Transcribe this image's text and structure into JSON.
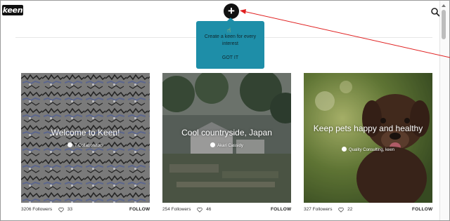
{
  "header": {
    "logo": "keen",
    "add_symbol": "+",
    "search_icon": "search-icon"
  },
  "tooltip": {
    "text": "Create a keen for every interest",
    "button": "GOT IT",
    "icon": "pointing-hand-icon"
  },
  "colors": {
    "tooltip_bg": "#1e8ea8",
    "arrow": "#e02020",
    "plus_bg": "#111111"
  },
  "cards": [
    {
      "title": "Welcome to Keen!",
      "owner": "7 Collaborators",
      "followers": "3206 Followers",
      "hearts": "33",
      "follow": "FOLLOW"
    },
    {
      "title": "Cool countryside, Japan",
      "owner": "Akari Cassidy",
      "followers": "254 Followers",
      "hearts": "46",
      "follow": "FOLLOW"
    },
    {
      "title": "Keep pets happy and healthy",
      "owner": "Quality Consulting, keen",
      "followers": "327 Followers",
      "hearts": "22",
      "follow": "FOLLOW"
    }
  ]
}
